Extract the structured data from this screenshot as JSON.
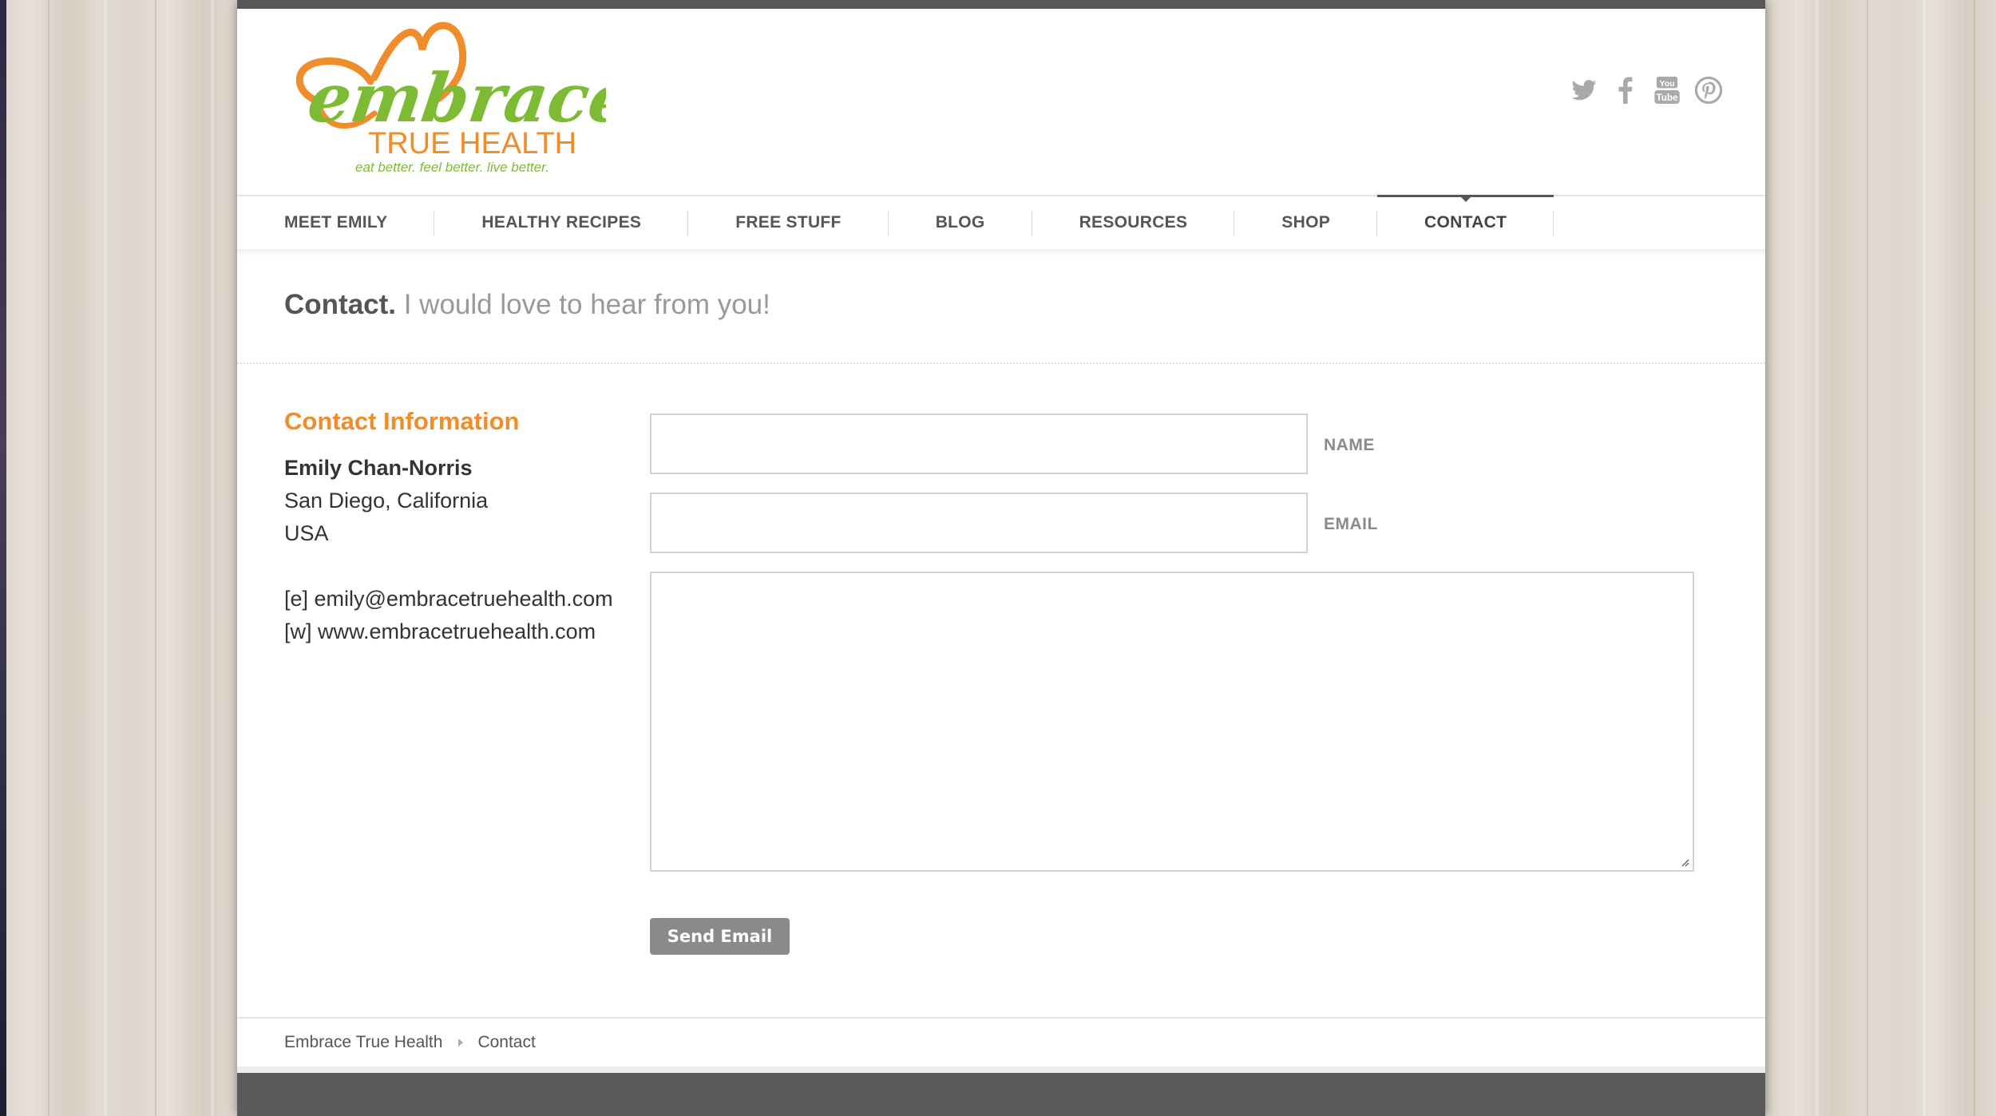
{
  "brand": {
    "logo_word": "embrace",
    "logo_sub": "TRUE HEALTH",
    "logo_tagline": "eat better. feel better. live better.",
    "colors": {
      "orange": "#f08c2a",
      "green": "#7dbb34"
    }
  },
  "social": [
    {
      "name": "twitter-icon"
    },
    {
      "name": "facebook-icon"
    },
    {
      "name": "youtube-icon"
    },
    {
      "name": "pinterest-icon"
    }
  ],
  "nav": {
    "items": [
      {
        "label": "MEET EMILY"
      },
      {
        "label": "HEALTHY RECIPES"
      },
      {
        "label": "FREE STUFF"
      },
      {
        "label": "BLOG"
      },
      {
        "label": "RESOURCES"
      },
      {
        "label": "SHOP"
      },
      {
        "label": "CONTACT",
        "active": true
      }
    ]
  },
  "page": {
    "title": "Contact.",
    "subtitle": "I would love to hear from you!"
  },
  "contact_info": {
    "heading": "Contact Information",
    "name": "Emily Chan-Norris",
    "city": "San Diego, California",
    "country": "USA",
    "email_line": "[e] emily@embracetruehealth.com",
    "web_line": "[w] www.embracetruehealth.com"
  },
  "form": {
    "name_label": "NAME",
    "name_value": "",
    "email_label": "EMAIL",
    "email_value": "",
    "message_value": "",
    "submit_label": "Send Email"
  },
  "breadcrumb": {
    "home": "Embrace True Health",
    "current": "Contact"
  }
}
